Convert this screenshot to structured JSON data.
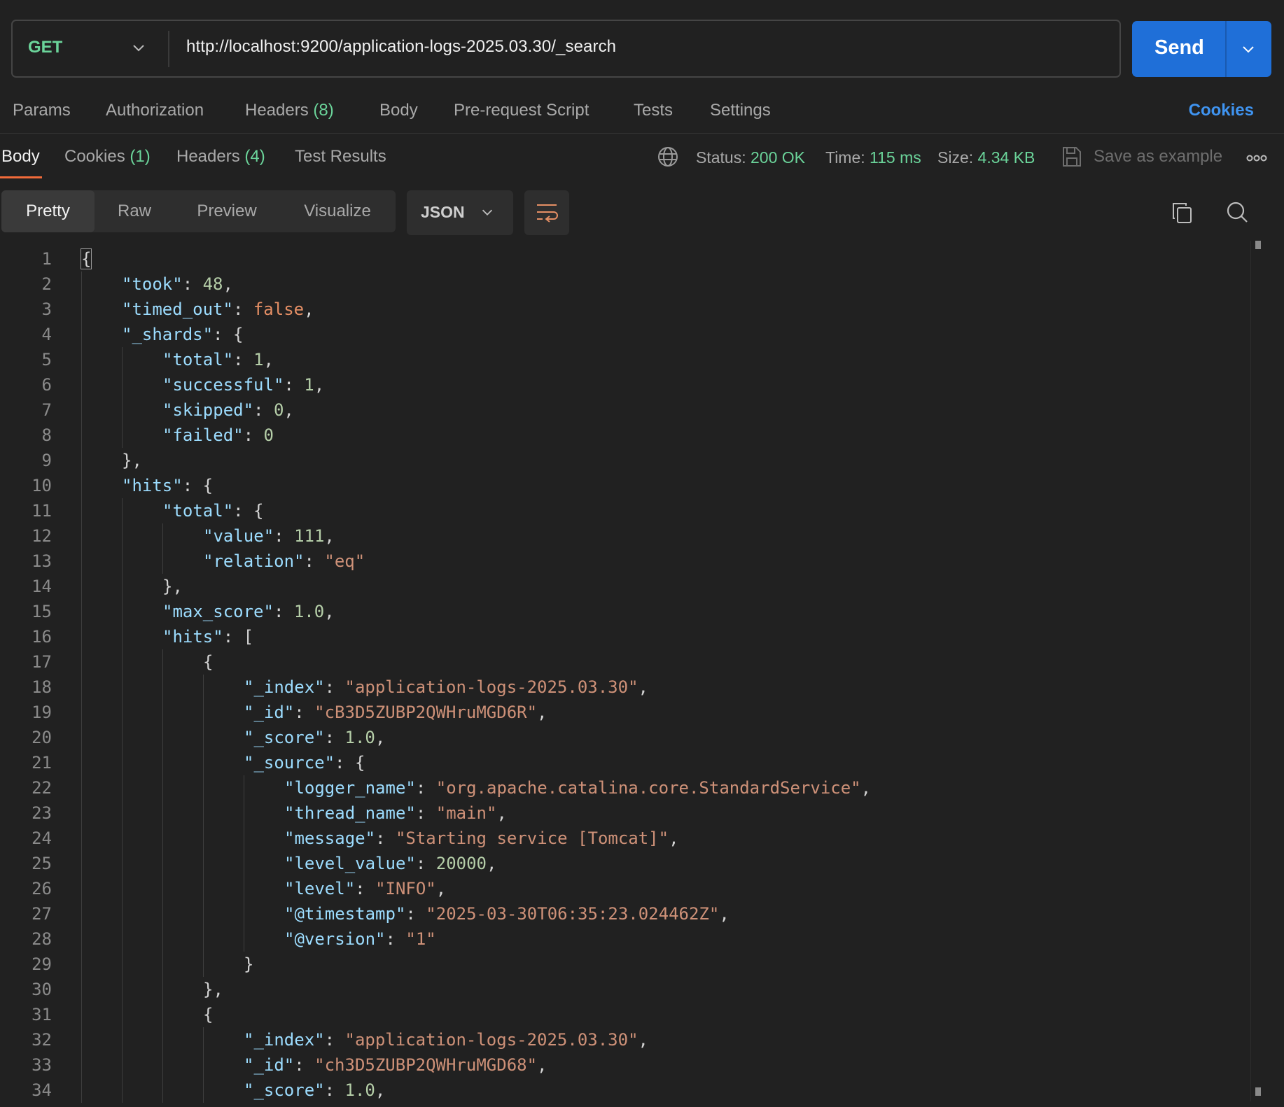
{
  "request": {
    "method": "GET",
    "url": "http://localhost:9200/application-logs-2025.03.30/_search",
    "send_label": "Send"
  },
  "request_tabs": {
    "params": "Params",
    "authorization": "Authorization",
    "headers": "Headers",
    "headers_count": "(8)",
    "body": "Body",
    "prerequest": "Pre-request Script",
    "tests": "Tests",
    "settings": "Settings",
    "cookies": "Cookies"
  },
  "response_tabs": {
    "body": "Body",
    "cookies": "Cookies",
    "cookies_count": "(1)",
    "headers": "Headers",
    "headers_count": "(4)",
    "test_results": "Test Results"
  },
  "status": {
    "status_label": "Status:",
    "status_value": "200 OK",
    "time_label": "Time:",
    "time_value": "115 ms",
    "size_label": "Size:",
    "size_value": "4.34 KB",
    "save_example": "Save as example"
  },
  "view": {
    "modes": [
      "Pretty",
      "Raw",
      "Preview",
      "Visualize"
    ],
    "active_mode": "Pretty",
    "format": "JSON"
  },
  "icons": [
    "chevron-down-icon",
    "globe-icon",
    "save-icon",
    "more-icon",
    "wrap-lines-icon",
    "copy-icon",
    "search-icon"
  ],
  "colors": {
    "accent": "#1f6fd8",
    "success": "#6bd49a",
    "link": "#3f94f1",
    "active_tab_underline": "#f26b3a"
  },
  "code_lines": [
    {
      "ln": "1",
      "indent": 0,
      "tokens": [
        [
          "p",
          "{"
        ]
      ]
    },
    {
      "ln": "2",
      "indent": 1,
      "tokens": [
        [
          "k",
          "\"took\""
        ],
        [
          "p",
          ": "
        ],
        [
          "n",
          "48"
        ],
        [
          "p",
          ","
        ]
      ]
    },
    {
      "ln": "3",
      "indent": 1,
      "tokens": [
        [
          "k",
          "\"timed_out\""
        ],
        [
          "p",
          ": "
        ],
        [
          "b",
          "false"
        ],
        [
          "p",
          ","
        ]
      ]
    },
    {
      "ln": "4",
      "indent": 1,
      "tokens": [
        [
          "k",
          "\"_shards\""
        ],
        [
          "p",
          ": {"
        ]
      ]
    },
    {
      "ln": "5",
      "indent": 2,
      "tokens": [
        [
          "k",
          "\"total\""
        ],
        [
          "p",
          ": "
        ],
        [
          "n",
          "1"
        ],
        [
          "p",
          ","
        ]
      ]
    },
    {
      "ln": "6",
      "indent": 2,
      "tokens": [
        [
          "k",
          "\"successful\""
        ],
        [
          "p",
          ": "
        ],
        [
          "n",
          "1"
        ],
        [
          "p",
          ","
        ]
      ]
    },
    {
      "ln": "7",
      "indent": 2,
      "tokens": [
        [
          "k",
          "\"skipped\""
        ],
        [
          "p",
          ": "
        ],
        [
          "n",
          "0"
        ],
        [
          "p",
          ","
        ]
      ]
    },
    {
      "ln": "8",
      "indent": 2,
      "tokens": [
        [
          "k",
          "\"failed\""
        ],
        [
          "p",
          ": "
        ],
        [
          "n",
          "0"
        ]
      ]
    },
    {
      "ln": "9",
      "indent": 1,
      "tokens": [
        [
          "p",
          "},"
        ]
      ]
    },
    {
      "ln": "10",
      "indent": 1,
      "tokens": [
        [
          "k",
          "\"hits\""
        ],
        [
          "p",
          ": {"
        ]
      ]
    },
    {
      "ln": "11",
      "indent": 2,
      "tokens": [
        [
          "k",
          "\"total\""
        ],
        [
          "p",
          ": {"
        ]
      ]
    },
    {
      "ln": "12",
      "indent": 3,
      "tokens": [
        [
          "k",
          "\"value\""
        ],
        [
          "p",
          ": "
        ],
        [
          "n",
          "111"
        ],
        [
          "p",
          ","
        ]
      ]
    },
    {
      "ln": "13",
      "indent": 3,
      "tokens": [
        [
          "k",
          "\"relation\""
        ],
        [
          "p",
          ": "
        ],
        [
          "s",
          "\"eq\""
        ]
      ]
    },
    {
      "ln": "14",
      "indent": 2,
      "tokens": [
        [
          "p",
          "},"
        ]
      ]
    },
    {
      "ln": "15",
      "indent": 2,
      "tokens": [
        [
          "k",
          "\"max_score\""
        ],
        [
          "p",
          ": "
        ],
        [
          "n",
          "1.0"
        ],
        [
          "p",
          ","
        ]
      ]
    },
    {
      "ln": "16",
      "indent": 2,
      "tokens": [
        [
          "k",
          "\"hits\""
        ],
        [
          "p",
          ": ["
        ]
      ]
    },
    {
      "ln": "17",
      "indent": 3,
      "tokens": [
        [
          "p",
          "{"
        ]
      ]
    },
    {
      "ln": "18",
      "indent": 4,
      "tokens": [
        [
          "k",
          "\"_index\""
        ],
        [
          "p",
          ": "
        ],
        [
          "s",
          "\"application-logs-2025.03.30\""
        ],
        [
          "p",
          ","
        ]
      ]
    },
    {
      "ln": "19",
      "indent": 4,
      "tokens": [
        [
          "k",
          "\"_id\""
        ],
        [
          "p",
          ": "
        ],
        [
          "s",
          "\"cB3D5ZUBP2QWHruMGD6R\""
        ],
        [
          "p",
          ","
        ]
      ]
    },
    {
      "ln": "20",
      "indent": 4,
      "tokens": [
        [
          "k",
          "\"_score\""
        ],
        [
          "p",
          ": "
        ],
        [
          "n",
          "1.0"
        ],
        [
          "p",
          ","
        ]
      ]
    },
    {
      "ln": "21",
      "indent": 4,
      "tokens": [
        [
          "k",
          "\"_source\""
        ],
        [
          "p",
          ": {"
        ]
      ]
    },
    {
      "ln": "22",
      "indent": 5,
      "tokens": [
        [
          "k",
          "\"logger_name\""
        ],
        [
          "p",
          ": "
        ],
        [
          "s",
          "\"org.apache.catalina.core.StandardService\""
        ],
        [
          "p",
          ","
        ]
      ]
    },
    {
      "ln": "23",
      "indent": 5,
      "tokens": [
        [
          "k",
          "\"thread_name\""
        ],
        [
          "p",
          ": "
        ],
        [
          "s",
          "\"main\""
        ],
        [
          "p",
          ","
        ]
      ]
    },
    {
      "ln": "24",
      "indent": 5,
      "tokens": [
        [
          "k",
          "\"message\""
        ],
        [
          "p",
          ": "
        ],
        [
          "s",
          "\"Starting service [Tomcat]\""
        ],
        [
          "p",
          ","
        ]
      ]
    },
    {
      "ln": "25",
      "indent": 5,
      "tokens": [
        [
          "k",
          "\"level_value\""
        ],
        [
          "p",
          ": "
        ],
        [
          "n",
          "20000"
        ],
        [
          "p",
          ","
        ]
      ]
    },
    {
      "ln": "26",
      "indent": 5,
      "tokens": [
        [
          "k",
          "\"level\""
        ],
        [
          "p",
          ": "
        ],
        [
          "s",
          "\"INFO\""
        ],
        [
          "p",
          ","
        ]
      ]
    },
    {
      "ln": "27",
      "indent": 5,
      "tokens": [
        [
          "k",
          "\"@timestamp\""
        ],
        [
          "p",
          ": "
        ],
        [
          "s",
          "\"2025-03-30T06:35:23.024462Z\""
        ],
        [
          "p",
          ","
        ]
      ]
    },
    {
      "ln": "28",
      "indent": 5,
      "tokens": [
        [
          "k",
          "\"@version\""
        ],
        [
          "p",
          ": "
        ],
        [
          "s",
          "\"1\""
        ]
      ]
    },
    {
      "ln": "29",
      "indent": 4,
      "tokens": [
        [
          "p",
          "}"
        ]
      ]
    },
    {
      "ln": "30",
      "indent": 3,
      "tokens": [
        [
          "p",
          "},"
        ]
      ]
    },
    {
      "ln": "31",
      "indent": 3,
      "tokens": [
        [
          "p",
          "{"
        ]
      ]
    },
    {
      "ln": "32",
      "indent": 4,
      "tokens": [
        [
          "k",
          "\"_index\""
        ],
        [
          "p",
          ": "
        ],
        [
          "s",
          "\"application-logs-2025.03.30\""
        ],
        [
          "p",
          ","
        ]
      ]
    },
    {
      "ln": "33",
      "indent": 4,
      "tokens": [
        [
          "k",
          "\"_id\""
        ],
        [
          "p",
          ": "
        ],
        [
          "s",
          "\"ch3D5ZUBP2QWHruMGD68\""
        ],
        [
          "p",
          ","
        ]
      ]
    },
    {
      "ln": "34",
      "indent": 4,
      "tokens": [
        [
          "k",
          "\"_score\""
        ],
        [
          "p",
          ": "
        ],
        [
          "n",
          "1.0"
        ],
        [
          "p",
          ","
        ]
      ]
    }
  ]
}
